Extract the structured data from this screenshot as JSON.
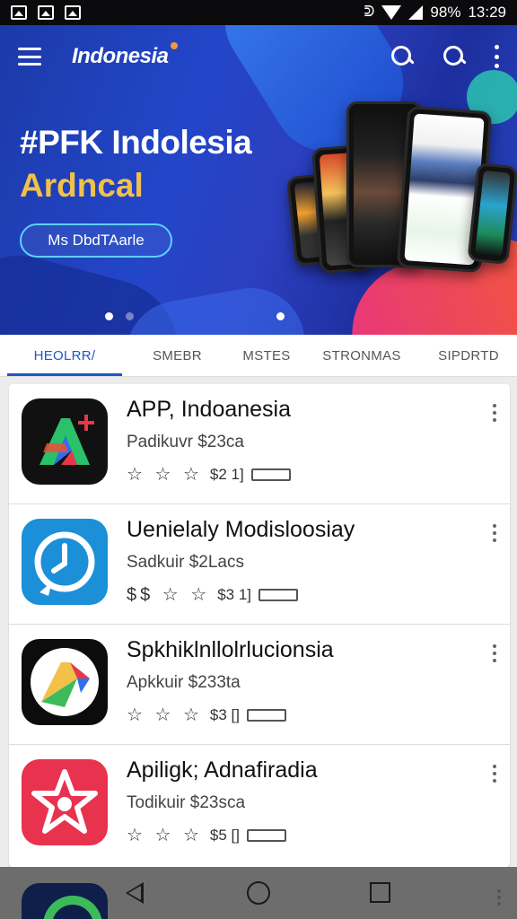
{
  "status_bar": {
    "battery": "98%",
    "time": "13:29"
  },
  "header": {
    "brand": "Indonesia"
  },
  "hero": {
    "title": "#PFK Indolesia",
    "subtitle": "Ardncal",
    "cta": "Ms DbdTAarle"
  },
  "tabs": [
    {
      "label": "HEOLRR/"
    },
    {
      "label": "SMEBR"
    },
    {
      "label": "MSTES"
    },
    {
      "label": "STRONMAS"
    },
    {
      "label": "SIPDRTD"
    }
  ],
  "apps": [
    {
      "name": "APP, Indoanesia",
      "developer": "Padikuvr $23ca",
      "rating": "☆ ☆ ☆",
      "size": "$2 1]"
    },
    {
      "name": "Uenielaly Modisloosiay",
      "developer": "Sadkuir $2Lacs",
      "rating": "$$ ☆ ☆",
      "size": "$3 1]"
    },
    {
      "name": "Spkhiklnllolrlucionsia",
      "developer": "Apkkuir $233ta",
      "rating": "☆ ☆ ☆",
      "size": "$3 []"
    },
    {
      "name": "Apiligk; Adnafiradia",
      "developer": "Todikuir $23sca",
      "rating": "☆ ☆ ☆",
      "size": "$5 []"
    }
  ],
  "colors": {
    "accent": "#1e58c8",
    "hero_bg": "#2346c9",
    "hero_subtitle": "#f2c14a"
  },
  "icons": [
    "menu-icon",
    "search-icon",
    "more-vert-icon",
    "back-icon",
    "home-icon",
    "recents-icon"
  ]
}
